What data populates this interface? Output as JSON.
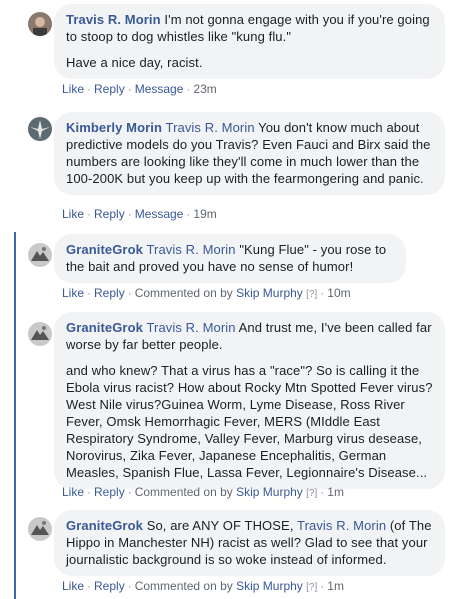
{
  "comments": [
    {
      "author": "Travis R. Morin",
      "paragraphs": [
        "I'm not gonna engage with you if you're going to stoop to dog whistles like \"kung flu.\"",
        "Have a nice day, racist."
      ],
      "actions": {
        "like": "Like",
        "reply": "Reply",
        "message": "Message",
        "time": "23m"
      }
    },
    {
      "author": "Kimberly Morin",
      "mention": "Travis R. Morin",
      "text": "You don't know much about predictive models do you Travis? Even Fauci and Birx said the numbers are looking like they'll come in much lower than the 100-200K but you keep up with the fearmongering and panic.",
      "actions": {
        "like": "Like",
        "reply": "Reply",
        "message": "Message",
        "time": "19m"
      }
    },
    {
      "author": "GraniteGrok",
      "mention": "Travis R. Morin",
      "text": "\"Kung Flue\" - you rose to the bait and proved you have no sense of humor!",
      "actions": {
        "like": "Like",
        "reply": "Reply",
        "commented_on_by": "Commented on by",
        "commenter": "Skip Murphy",
        "badge": "[?]",
        "time": "10m"
      }
    },
    {
      "author": "GraniteGrok",
      "mention": "Travis R. Morin",
      "text": "And trust me, I've been called far worse by far better people.",
      "text2": "and who knew? That a virus has a \"race\"? So is calling it the Ebola virus racist? How about Rocky Mtn Spotted Fever virus? West Nile virus?Guinea Worm, Lyme Disease, Ross River Fever, Omsk Hemorrhagic Fever, MERS (MIddle East Respiratory Syndrome, Valley Fever, Marburg virus desease, Norovirus, Zika Fever, Japanese Encephalitis, German Measles, Spanish Flue, Lassa Fever, Legionnaire's Disease...",
      "actions": {
        "like": "Like",
        "reply": "Reply",
        "commented_on_by": "Commented on by",
        "commenter": "Skip Murphy",
        "badge": "[?]",
        "time": "1m"
      }
    },
    {
      "author": "GraniteGrok",
      "text_before": "So, are ANY OF THOSE,",
      "mention": "Travis R. Morin",
      "text_after": "(of The Hippo in Manchester NH) racist as well? Glad to see that your journalistic background is so woke instead of informed.",
      "actions": {
        "like": "Like",
        "reply": "Reply",
        "commented_on_by": "Commented on by",
        "commenter": "Skip Murphy",
        "badge": "[?]",
        "time": "1m"
      }
    }
  ],
  "separator": "·",
  "colors": {
    "link": "#385898",
    "bubble": "#f2f3f5",
    "thread_line": "#4267b2",
    "meta": "#606770"
  }
}
